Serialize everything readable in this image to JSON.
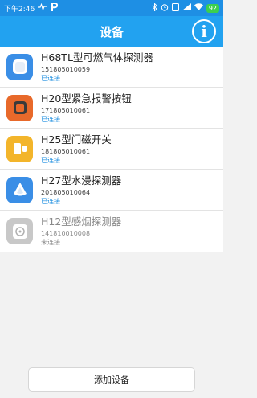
{
  "status_bar": {
    "time": "下午2:46",
    "left_icons": [
      "heart-monitor-icon",
      "p-app-icon"
    ],
    "right_icons": [
      "bluetooth-icon",
      "alarm-icon",
      "screen-icon",
      "signal-icon",
      "wifi-icon"
    ],
    "battery": "92"
  },
  "header": {
    "title": "设备",
    "info_label": "i"
  },
  "devices": [
    {
      "name": "H68TL型可燃气体探测器",
      "serial": "151805010059",
      "status": "已连接",
      "icon": "gas-detector-icon",
      "color": "#3a8ee6"
    },
    {
      "name": "H20型紧急报警按钮",
      "serial": "171805010061",
      "status": "已连接",
      "icon": "emergency-button-icon",
      "color": "#e8692a"
    },
    {
      "name": "H25型门磁开关",
      "serial": "181805010061",
      "status": "已连接",
      "icon": "door-sensor-icon",
      "color": "#f3b52b"
    },
    {
      "name": "H27型水浸探测器",
      "serial": "201805010064",
      "status": "已连接",
      "icon": "water-leak-detector-icon",
      "color": "#3a8ee6"
    },
    {
      "name": "H12型感烟探测器",
      "serial": "141810010008",
      "status": "未连接",
      "icon": "smoke-detector-icon",
      "color": "#c8c8c8"
    }
  ],
  "add_button": {
    "label": "添加设备"
  },
  "colors": {
    "status_bar": "#1e8fe4",
    "header": "#22a2f0",
    "connected": "#1f8fe0"
  }
}
